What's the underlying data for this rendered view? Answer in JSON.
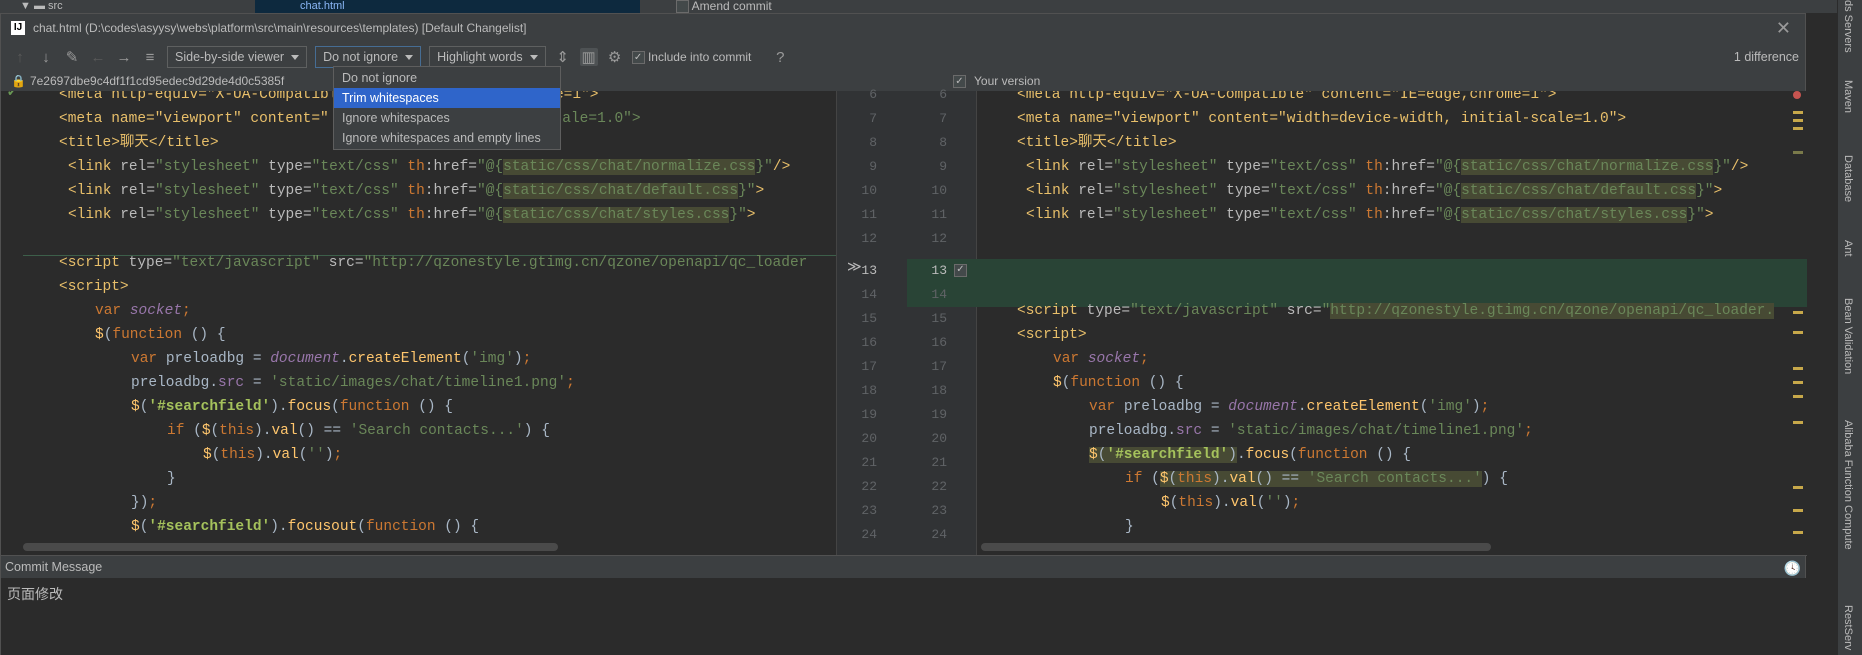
{
  "top": {
    "tree_item": "src",
    "selected_file": "chat.html",
    "amend_commit": "Amend commit"
  },
  "title": {
    "app_icon": "IJ",
    "text": "chat.html (D:\\codes\\asyysy\\webs\\platform\\src\\main\\resources\\templates) [Default Changelist]"
  },
  "toolbar": {
    "viewer": "Side-by-side viewer",
    "ignore": "Do not ignore",
    "highlight": "Highlight words",
    "include_label": "Include into commit",
    "help": "?",
    "difference_count": "1 difference"
  },
  "dropdown": {
    "items": [
      "Do not ignore",
      "Trim whitespaces",
      "Ignore whitespaces",
      "Ignore whitespaces and empty lines"
    ],
    "selected": 1
  },
  "header": {
    "revision": "7e2697dbe9c4df1f1cd95edec9d29de4d0c5385f",
    "your_version": "Your version"
  },
  "left_lines": [
    "6",
    "7",
    "8",
    "9",
    "10",
    "11",
    "12",
    "13",
    "14",
    "15",
    "16",
    "17",
    "18",
    "19",
    "20",
    "21",
    "22",
    "23",
    "24"
  ],
  "right_lines": [
    "6",
    "7",
    "8",
    "9",
    "10",
    "11",
    "12",
    "13",
    "14",
    "15",
    "16",
    "17",
    "18",
    "19",
    "20",
    "21",
    "22",
    "23",
    "24"
  ],
  "code": {
    "l1": "<meta http-equiv=\"X-UA-Compatible\" content=\"IE=edge,chrome=1\">",
    "l2a": "<meta name=\"viewport\" content=\"",
    "l2b": "al-scale=1.0\">",
    "r2": "<meta name=\"viewport\" content=\"width=device-width, initial-scale=1.0\">",
    "l3": "<title>聊天</title>",
    "css1": "static/css/chat/normalize.css",
    "css2": "static/css/chat/default.css",
    "css3": "static/css/chat/styles.css",
    "script_src": "http://qzonestyle.gtimg.cn/qzone/openapi/qc_loader",
    "script_src_r": "http://qzonestyle.gtimg.cn/qzone/openapi/qc_loader.",
    "img": "'img'",
    "png": "'static/images/chat/timeline1.png'",
    "searchfield": "'#searchfield'",
    "search_contacts": "'Search contacts...'",
    "empty_str": "''"
  },
  "commit": {
    "header": "Commit Message",
    "message": "页面修改"
  },
  "sidebar": {
    "items": [
      "Maven",
      "Database",
      "Ant",
      "Bean Validation",
      "Alibaba Function Compute",
      "RestServ"
    ],
    "top_label": "ds Servers"
  },
  "colors": {
    "selection": "#2f65ca",
    "changed_band": "#294436",
    "background": "#2b2b2b",
    "panel": "#3c3f41"
  }
}
